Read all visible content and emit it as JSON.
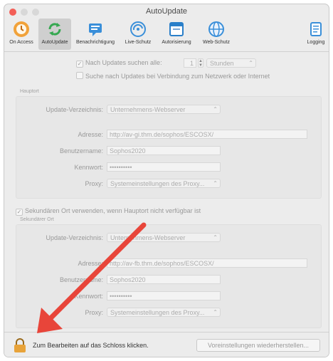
{
  "window": {
    "title": "AutoUpdate"
  },
  "toolbar": {
    "items": [
      {
        "label": "On Access",
        "icon": "on-access-icon"
      },
      {
        "label": "AutoUpdate",
        "icon": "autoupdate-icon"
      },
      {
        "label": "Benachrichtigung",
        "icon": "notification-icon"
      },
      {
        "label": "Live-Schutz",
        "icon": "live-protection-icon"
      },
      {
        "label": "Autorisierung",
        "icon": "authorization-icon"
      },
      {
        "label": "Web-Schutz",
        "icon": "web-protection-icon"
      },
      {
        "label": "Logging",
        "icon": "logging-icon"
      }
    ],
    "active_index": 1
  },
  "settings": {
    "check_updates_label": "Nach Updates suchen alle:",
    "check_updates_checked": true,
    "interval_value": "1",
    "interval_unit": "Stunden",
    "network_search_label": "Suche nach Updates bei Verbindung zum Netzwerk oder Internet",
    "network_search_checked": false
  },
  "primary": {
    "group_label": "Hauptort",
    "update_dir_label": "Update-Verzeichnis:",
    "update_dir_value": "Unternehmens-Webserver",
    "address_label": "Adresse:",
    "address_value": "http://av-gi.thm.de/sophos/ESCOSX/",
    "username_label": "Benutzername:",
    "username_value": "Sophos2020",
    "password_label": "Kennwort:",
    "password_value": "••••••••••",
    "proxy_label": "Proxy:",
    "proxy_value": "Systemeinstellungen des Proxy..."
  },
  "secondary": {
    "use_label": "Sekundären Ort verwenden, wenn Hauptort nicht verfügbar ist",
    "use_checked": true,
    "group_label": "Sekundärer Ort",
    "update_dir_label": "Update-Verzeichnis:",
    "update_dir_value": "Unternehmens-Webserver",
    "address_label": "Adresse:",
    "address_value": "http://av-fb.thm.de/sophos/ESCOSX/",
    "username_label": "Benutzername:",
    "username_value": "Sophos2020",
    "password_label": "Kennwort:",
    "password_value": "••••••••••",
    "proxy_label": "Proxy:",
    "proxy_value": "Systemeinstellungen des Proxy..."
  },
  "footer": {
    "lock_message": "Zum Bearbeiten auf das Schloss klicken.",
    "reset_button": "Voreinstellungen wiederherstellen..."
  },
  "colors": {
    "arrow": "#e8453a",
    "lock": "#e8a33a",
    "accent": "#2f8bd6"
  }
}
